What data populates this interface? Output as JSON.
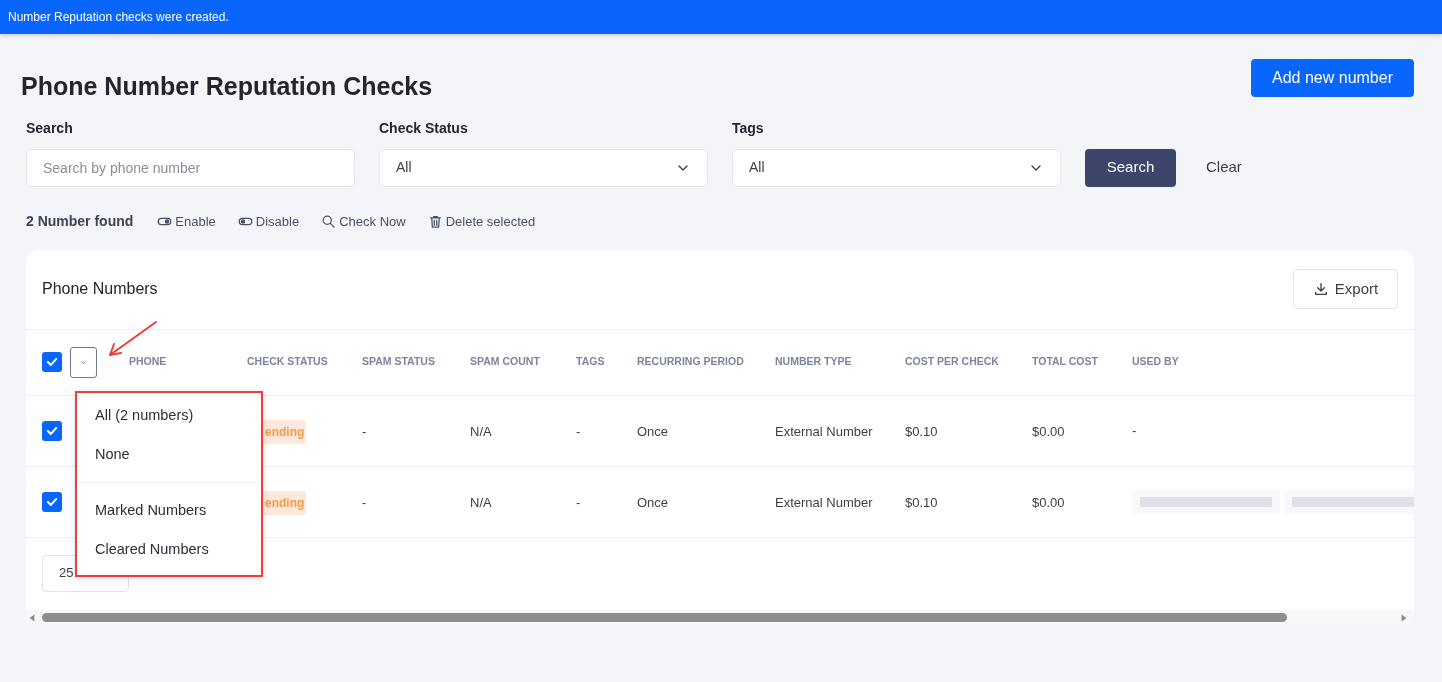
{
  "notification": "Number Reputation checks were created.",
  "title": "Phone Number Reputation Checks",
  "add_button": "Add new number",
  "filters": [
    {
      "kind": "text",
      "label": "Search",
      "placeholder": "Search by phone number"
    },
    {
      "kind": "select",
      "label": "Check Status",
      "value": "All"
    },
    {
      "kind": "select",
      "label": "Tags",
      "value": "All"
    }
  ],
  "search_button": "Search",
  "clear_button": "Clear",
  "count": "2 Number found",
  "actions": [
    {
      "kind": "enable",
      "label": "Enable"
    },
    {
      "kind": "disable",
      "label": "Disable"
    },
    {
      "kind": "check",
      "label": "Check Now"
    },
    {
      "kind": "delete",
      "label": "Delete selected"
    }
  ],
  "table": {
    "title": "Phone Numbers",
    "export_button": "Export",
    "select_all_checked": true,
    "columns": [
      "PHONE",
      "CHECK STATUS",
      "SPAM STATUS",
      "SPAM COUNT",
      "TAGS",
      "RECURRING PERIOD",
      "NUMBER TYPE",
      "COST PER CHECK",
      "TOTAL COST",
      "USED BY"
    ],
    "rows": [
      {
        "checked": true,
        "check_status": "ending",
        "spam_status": "-",
        "spam_count": "N/A",
        "tags": "-",
        "recurring_period": "Once",
        "number_type": "External Number",
        "cost_per_check": "$0.10",
        "total_cost": "$0.00",
        "used_by": "-"
      },
      {
        "checked": true,
        "check_status": "ending",
        "spam_status": "-",
        "spam_count": "N/A",
        "tags": "-",
        "recurring_period": "Once",
        "number_type": "External Number",
        "cost_per_check": "$0.10",
        "total_cost": "$0.00",
        "used_by_redacted": true
      }
    ],
    "page_size": "25"
  },
  "select_menu": [
    "All (2 numbers)",
    "None",
    "Marked Numbers",
    "Cleared Numbers"
  ]
}
